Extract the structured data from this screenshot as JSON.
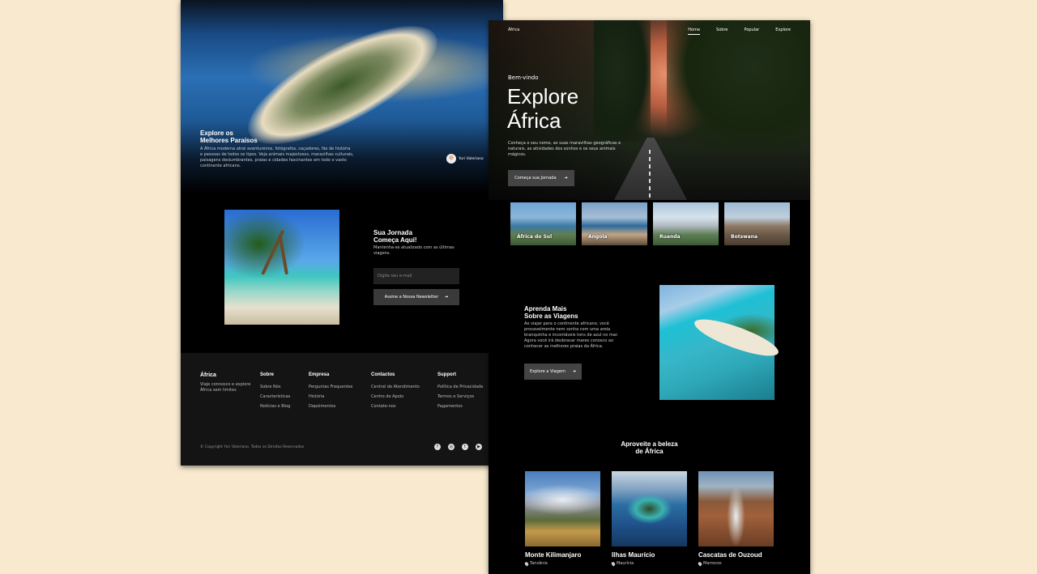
{
  "left_page": {
    "hero": {
      "title": "Explore os\nMelhores Paraísos",
      "description": "A África moderna atrai aventureiros, fotógrafos, caçadores, fãs de história e pessoas de todos os tipos. Veja animais majestosos, maravilhas culturais, paisagens deslumbrantes, praias e cidades fascinantes em todo o vasto continente africano.",
      "author": "Yuri Valeriano"
    },
    "newsletter": {
      "title": "Sua Jornada\nComeça Aqui!",
      "subtitle": "Mantenha-se atualizado com as últimas viagens.",
      "email_placeholder": "Digite seu e-mail",
      "subscribe_label": "Assine a Nossa Newsletter"
    },
    "footer": {
      "brand": "África",
      "brand_text": "Viaje connosco e explore África sem limites",
      "columns": [
        {
          "title": "Sobre",
          "links": [
            "Sobre Nós",
            "Características",
            "Notícias e Blog"
          ]
        },
        {
          "title": "Empresa",
          "links": [
            "Perguntas Frequentes",
            "História",
            "Depoimentos"
          ]
        },
        {
          "title": "Contactos",
          "links": [
            "Central de Atendimento",
            "Centro de Apoio",
            "Contate-nos"
          ]
        },
        {
          "title": "Support",
          "links": [
            "Política de Privacidade",
            "Termos e Serviços",
            "Pagamentos"
          ]
        }
      ],
      "copyright": "© Copyright Yuri Valeriano. Todos os Direitos Reservados",
      "socials": [
        "facebook-icon",
        "instagram-icon",
        "twitter-icon",
        "youtube-icon"
      ]
    }
  },
  "right_page": {
    "nav": {
      "brand": "África",
      "links": [
        "Home",
        "Sobre",
        "Popular",
        "Explore"
      ],
      "active": "Home"
    },
    "hero": {
      "welcome": "Bem-vindo",
      "title": "Explore\nÁfrica",
      "description": "Conheça o seu nome, as suas maravilhas geográficas e naturais, as atividades dos sonhos e os seus animais mágicos.",
      "button": "Começa sua Jornada"
    },
    "countries": [
      "África do Sul",
      "Angola",
      "Ruanda",
      "Botswana"
    ],
    "learn": {
      "title": "Aprenda Mais\nSobre as Viagens",
      "text": "Ao viajar para o continente africano, você provavelmente nem sonha com uma areia branquinha e incontáveis tons de azul no mar. Agora você irá desbravar mares conosco ao conhecer as melhores praias da África.",
      "button": "Explore a Viagem"
    },
    "enjoy_title": "Aproveite a beleza\nde África",
    "places": [
      {
        "name": "Monte Kilimanjaro",
        "location": "Tanzânia"
      },
      {
        "name": "Ilhas Maurício",
        "location": "Maurícia"
      },
      {
        "name": "Cascatas de Ouzoud",
        "location": "Marrocos"
      }
    ]
  },
  "colors": {
    "background": "#f8e9cf",
    "page_background": "#000000",
    "footer_background": "#141414",
    "button": "#444444"
  }
}
